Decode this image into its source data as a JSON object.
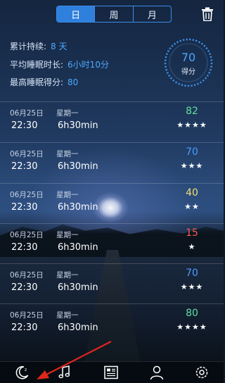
{
  "tabs": [
    {
      "label": "日",
      "active": true
    },
    {
      "label": "周",
      "active": false
    },
    {
      "label": "月",
      "active": false
    }
  ],
  "stats": {
    "streak_label": "累计持续:",
    "streak_value": "8 天",
    "avg_label": "平均睡眠时长:",
    "avg_value": "6小时10分",
    "best_label": "最高睡眠得分:",
    "best_value": "80"
  },
  "score_ring": {
    "value": "70",
    "label": "得分",
    "color": "#4aa6ff"
  },
  "records": [
    {
      "date": "06月25日",
      "weekday": "星期一",
      "time": "22:30",
      "duration": "6h30min",
      "score": "82",
      "score_color": "#5fe0a0",
      "stars": "★★★★"
    },
    {
      "date": "06月25日",
      "weekday": "星期一",
      "time": "22:30",
      "duration": "6h30min",
      "score": "70",
      "score_color": "#4a9cff",
      "stars": "★★★"
    },
    {
      "date": "06月25日",
      "weekday": "星期一",
      "time": "22:30",
      "duration": "6h30min",
      "score": "40",
      "score_color": "#f0e070",
      "stars": "★★"
    },
    {
      "date": "06月25日",
      "weekday": "星期一",
      "time": "22:30",
      "duration": "6h30min",
      "score": "15",
      "score_color": "#ff5a4a",
      "stars": "★"
    },
    {
      "date": "06月25日",
      "weekday": "星期一",
      "time": "22:30",
      "duration": "6h30min",
      "score": "70",
      "score_color": "#4a9cff",
      "stars": "★★★"
    },
    {
      "date": "06月25日",
      "weekday": "星期一",
      "time": "22:30",
      "duration": "6h30min",
      "score": "80",
      "score_color": "#5fe0a0",
      "stars": "★★★★"
    }
  ],
  "nav": [
    {
      "icon": "moon-icon",
      "active": true
    },
    {
      "icon": "music-icon",
      "active": false
    },
    {
      "icon": "report-icon",
      "active": false
    },
    {
      "icon": "user-icon",
      "active": false
    },
    {
      "icon": "settings-icon",
      "active": false
    }
  ],
  "colors": {
    "accent": "#2f7fdc",
    "value_blue": "#4da9ff",
    "arrow": "#e0251b"
  }
}
